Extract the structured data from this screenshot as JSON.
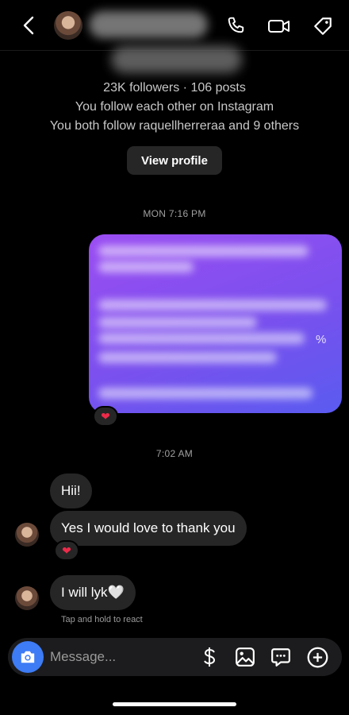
{
  "header": {
    "back_icon": "chevron-left-icon",
    "call_icon": "phone-icon",
    "video_icon": "video-camera-icon",
    "tag_icon": "tag-icon"
  },
  "profile": {
    "stats": "23K followers · 106 posts",
    "mutual_follow": "You follow each other on Instagram",
    "mutual_followers": "You both follow raquellherreraa and 9 others",
    "view_profile_label": "View profile"
  },
  "thread": {
    "timestamp_1": "MON 7:16 PM",
    "sent_message_visible_fragment": "%",
    "reaction_1": "❤",
    "timestamp_2": "7:02 AM",
    "messages": [
      {
        "text": "Hii!"
      },
      {
        "text": "Yes I would love to thank you"
      },
      {
        "text": "I will lyk🤍"
      }
    ],
    "reaction_2": "❤",
    "hint": "Tap and hold to react"
  },
  "composer": {
    "placeholder": "Message...",
    "camera_icon": "camera-icon",
    "payment_icon": "dollar-icon",
    "gallery_icon": "image-icon",
    "sticker_icon": "chat-bubble-icon",
    "add_icon": "plus-circle-icon"
  },
  "colors": {
    "background": "#000000",
    "bubble": "#262626",
    "accent_blue": "#3d7cf5",
    "sent_gradient_start": "#9b4df2",
    "sent_gradient_end": "#5a5bf0",
    "heart": "#ed2a4a"
  }
}
